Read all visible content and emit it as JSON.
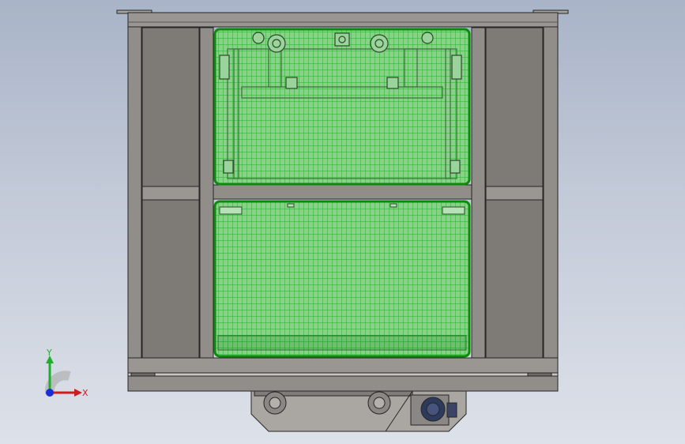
{
  "triad": {
    "x_label": "X",
    "y_label": "Y",
    "colors": {
      "x": "#cc1e1e",
      "y": "#1fae2c",
      "z": "#1a2bd8"
    }
  },
  "model": {
    "colors": {
      "frame_fill": "#918e8a",
      "frame_dark": "#6e6b67",
      "frame_line": "#262626",
      "panel_fill": "#7e7b77",
      "mesh_fill": "#8ad08a",
      "mesh_line": "#27b52a",
      "mesh_border": "#0c8a0c",
      "motor": "#2e3a5c"
    }
  }
}
